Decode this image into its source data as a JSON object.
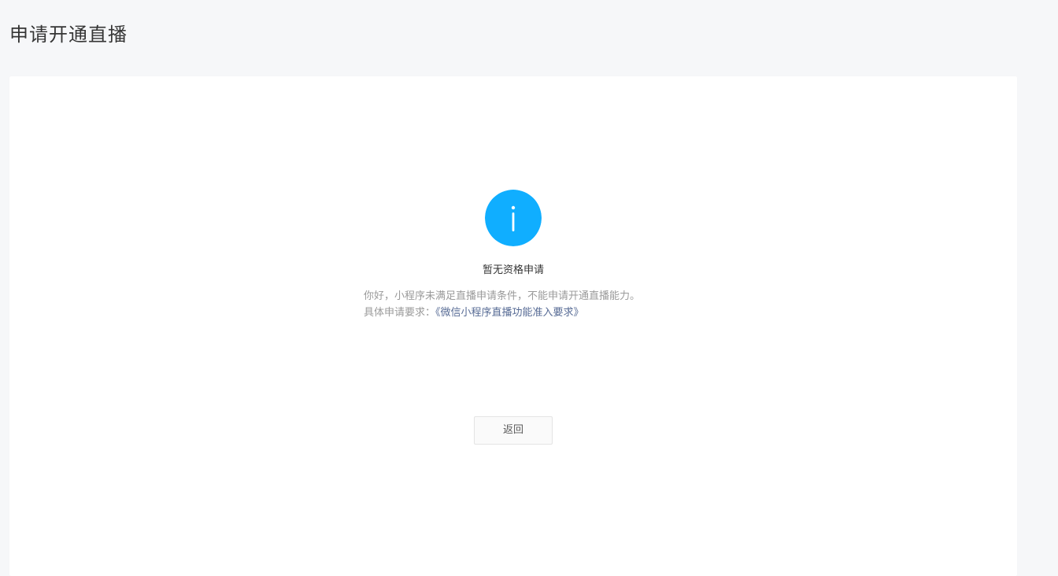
{
  "page": {
    "title": "申请开通直播"
  },
  "status": {
    "icon": "info-icon",
    "icon_color": "#10aeff",
    "title": "暂无资格申请",
    "line1": "你好，小程序未满足直播申请条件，不能申请开通直播能力。",
    "line2_prefix": "具体申请要求：",
    "line2_link": "《微信小程序直播功能准入要求》"
  },
  "actions": {
    "back_label": "返回"
  },
  "colors": {
    "background": "#f6f7f9",
    "card": "#ffffff",
    "link": "#576b95"
  }
}
